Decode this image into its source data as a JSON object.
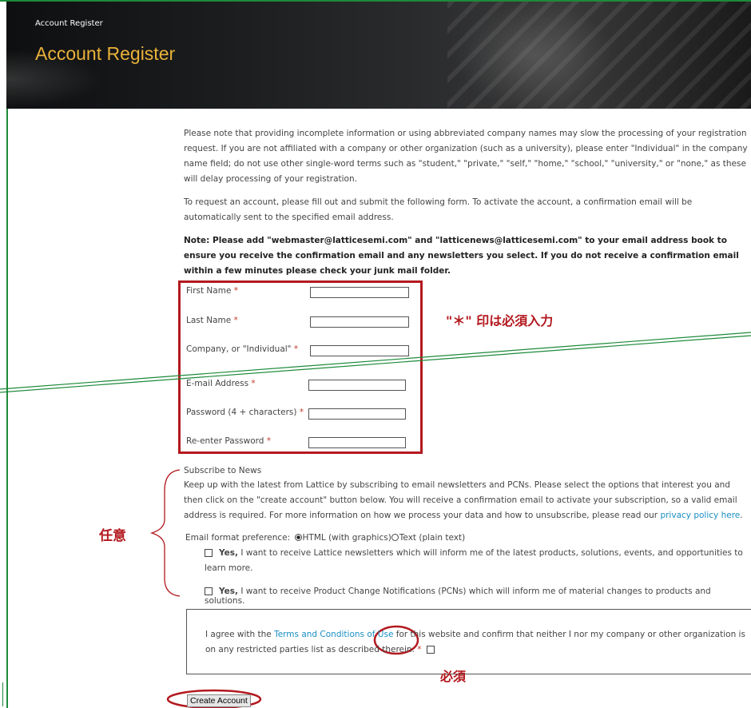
{
  "header": {
    "breadcrumb": "Account Register",
    "title": "Account Register"
  },
  "intro": {
    "para1": "Please note that providing incomplete information or using abbreviated company names may slow the processing of your registration request. If you are not affiliated with a company or other organization (such as a university), please enter \"Individual\" in the company name field; do not use other single-word terms such as \"student,\" \"private,\" \"self,\" \"home,\" \"school,\" \"university,\" or \"none,\" as these will delay processing of your registration.",
    "para2": "To request an account, please fill out and submit the following form. To activate the account, a confirmation email will be automatically sent to the specified email address.",
    "note": "Note: Please add \"webmaster@latticesemi.com\" and \"latticenews@latticesemi.com\" to your email address book to ensure you receive the confirmation email and any newsletters you select. If you do not receive a confirmation email within a few minutes please check your junk mail folder."
  },
  "form": {
    "required_mark": "*",
    "fields": [
      {
        "label": "First Name",
        "value": ""
      },
      {
        "label": "Last Name",
        "value": ""
      },
      {
        "label": "Company, or \"Individual\"",
        "value": ""
      },
      {
        "label": "E-mail Address",
        "value": ""
      },
      {
        "label": "Password (4 + characters)",
        "value": ""
      },
      {
        "label": "Re-enter Password",
        "value": ""
      }
    ]
  },
  "subscribe": {
    "heading": "Subscribe to News",
    "text": "Keep up with the latest from Lattice by subscribing to email newsletters and PCNs. Please select the options that interest you and then click on the \"create account\" button below. You will receive a confirmation email to activate your subscription, so a valid email address is required. For more information on how we process your data and how to unsubscribe, please read our",
    "link": "privacy policy here",
    "link_suffix": ".",
    "format_label": "Email format preference:",
    "format_html": "HTML (with graphics)",
    "format_text": "Text (plain text)",
    "format_selected": "html",
    "option1_yes": "Yes,",
    "option1_text": " I want to receive Lattice newsletters which will inform me of the latest products, solutions, events, and opportunities to learn more.",
    "option2_yes": "Yes,",
    "option2_text": " I want to receive Product Change Notifications (PCNs) which will inform me of material changes to products and solutions."
  },
  "terms": {
    "before": "I agree with the ",
    "link": "Terms and Conditions of Use",
    "after": " for this website and confirm that neither I nor my company or other organization is on any restricted parties list as described therein.",
    "mark": " *"
  },
  "buttons": {
    "create_account": "Create Account"
  },
  "annotations": {
    "required_note": "\"＊\" 印は必須入力",
    "optional": "任意",
    "must": "必須"
  },
  "colors": {
    "accent_title": "#e9b23a",
    "annotation_red": "#b3191f",
    "link_blue": "#1a8ec2",
    "edge_green": "#1d8a3a"
  }
}
